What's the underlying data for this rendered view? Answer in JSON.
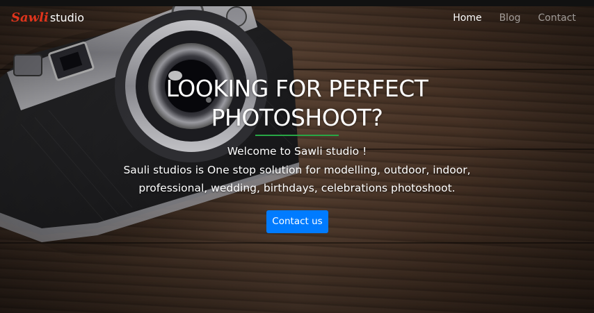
{
  "brand": {
    "script": "Sawli",
    "word": "studio"
  },
  "nav": {
    "items": [
      {
        "label": "Home",
        "active": true
      },
      {
        "label": "Blog",
        "active": false
      },
      {
        "label": "Contact",
        "active": false
      }
    ]
  },
  "hero": {
    "headline_line1": "LOOKING FOR PERFECT",
    "headline_line2": "PHOTOSHOOT?",
    "welcome": "Welcome to Sawli studio !",
    "description_line1": "Sauli studios is One stop solution for modelling, outdoor, indoor,",
    "description_line2": "professional, wedding, birthdays, celebrations photoshoot.",
    "cta_label": "Contact us",
    "background_image": "vintage-camera-on-wooden-table"
  },
  "colors": {
    "brand_script": "#e0341c",
    "cta": "#007bff",
    "accent_underline": "#28a745",
    "text": "#ffffff"
  }
}
